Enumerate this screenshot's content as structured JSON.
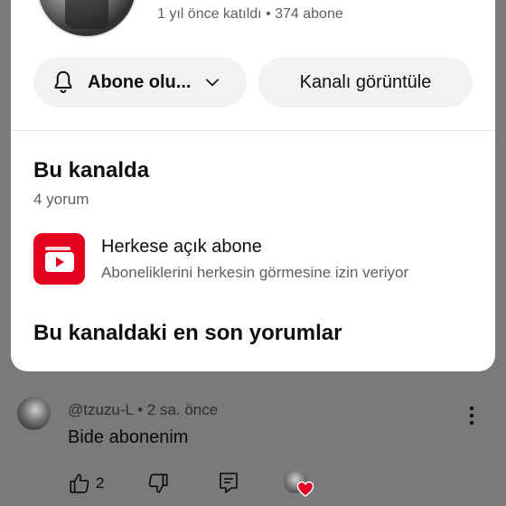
{
  "channel": {
    "joined_text": "1 yıl önce katıldı • 374 abone"
  },
  "buttons": {
    "subscribe_label": "Abone olu...",
    "view_channel_label": "Kanalı görüntüle"
  },
  "on_channel": {
    "title": "Bu kanalda",
    "comments_count": "4 yorum",
    "public_sub": {
      "title": "Herkese açık abone",
      "description": "Aboneliklerini herkesin görmesine izin veriyor"
    },
    "recent_title": "Bu kanaldaki en son yorumlar"
  },
  "comment": {
    "meta": "@tzuzu-L • 2 sa. önce",
    "text": "Bide abonenim",
    "like_count": "2"
  },
  "colors": {
    "accent_red": "#e4001f",
    "heart_red": "#e4001f"
  },
  "icons": [
    "bell-icon",
    "chevron-down-icon",
    "play-icon",
    "more-vert-icon",
    "thumb-up-icon",
    "thumb-down-icon",
    "reply-icon",
    "heart-icon"
  ]
}
